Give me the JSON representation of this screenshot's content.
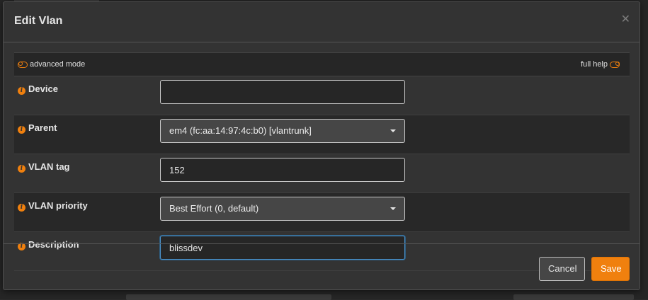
{
  "modal": {
    "title": "Edit Vlan"
  },
  "toggles": {
    "advanced_mode_label": "advanced mode",
    "full_help_label": "full help"
  },
  "fields": {
    "device": {
      "label": "Device",
      "value": ""
    },
    "parent": {
      "label": "Parent",
      "value": "em4 (fc:aa:14:97:4c:b0) [vlantrunk]"
    },
    "vlan_tag": {
      "label": "VLAN tag",
      "value": "152"
    },
    "vlan_priority": {
      "label": "VLAN priority",
      "value": "Best Effort (0, default)"
    },
    "description": {
      "label": "Description",
      "value": "blissdev"
    }
  },
  "footer": {
    "cancel_label": "Cancel",
    "save_label": "Save"
  },
  "colors": {
    "accent": "#f0800e",
    "background": "#333333",
    "focus_border": "#4a90c8"
  },
  "icons": {
    "info": "info-icon",
    "close": "close-icon",
    "toggle": "toggle-off-icon",
    "dropdown": "caret-down-icon"
  }
}
